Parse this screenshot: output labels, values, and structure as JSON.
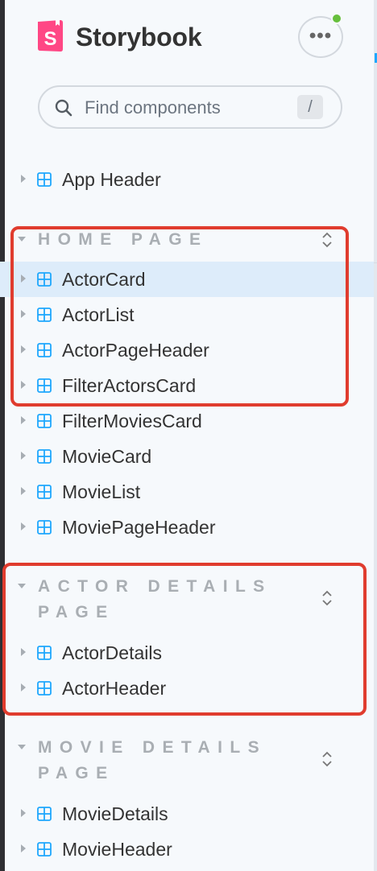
{
  "app": {
    "brand": "Storybook",
    "logo_letter": "S",
    "brand_color": "#ff4785",
    "status_color": "#66bf3c",
    "menu_icon": "ellipsis-icon",
    "menu_label": "•••"
  },
  "search": {
    "placeholder": "Find components",
    "shortcut": "/"
  },
  "tree": {
    "top_items": [
      {
        "label": "App Header"
      }
    ],
    "groups": [
      {
        "title": "HOME PAGE",
        "items": [
          {
            "label": "ActorCard",
            "selected": true
          },
          {
            "label": "ActorList"
          },
          {
            "label": "ActorPageHeader"
          },
          {
            "label": "FilterActorsCard"
          },
          {
            "label": "FilterMoviesCard"
          },
          {
            "label": "MovieCard"
          },
          {
            "label": "MovieList"
          },
          {
            "label": "MoviePageHeader"
          }
        ]
      },
      {
        "title": "ACTOR DETAILS PAGE",
        "items": [
          {
            "label": "ActorDetails"
          },
          {
            "label": "ActorHeader"
          }
        ]
      },
      {
        "title": "MOVIE DETAILS PAGE",
        "items": [
          {
            "label": "MovieDetails"
          },
          {
            "label": "MovieHeader"
          }
        ]
      }
    ]
  },
  "colors": {
    "component_icon": "#1ea7fd",
    "selected_row": "#ddecfa",
    "annotation": "#e03c2e",
    "group_title": "#a9aeb3"
  }
}
